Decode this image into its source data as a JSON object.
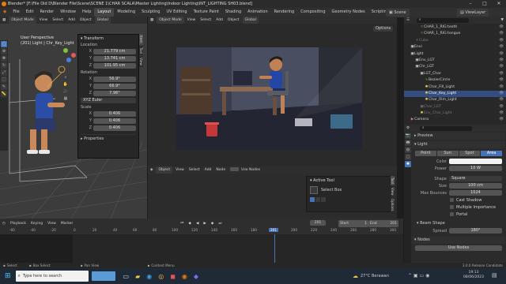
{
  "window": {
    "title": "Blender* [F:\\File Old D\\Blender File\\Scene\\SCENE 1\\CHAR SCALA\\Master Lighting\\Indoor Lighting\\INT_LIGHTING SH03.blend]"
  },
  "menu": {
    "items": [
      "File",
      "Edit",
      "Render",
      "Window",
      "Help"
    ],
    "workspaces": [
      "Layout",
      "Modeling",
      "Sculpting",
      "UV Editing",
      "Texture Paint",
      "Shading",
      "Animation",
      "Rendering",
      "Compositing",
      "Geometry Nodes",
      "Scripting"
    ],
    "active_workspace": "Layout",
    "scene_label": "Scene",
    "viewlayer_label": "ViewLayer"
  },
  "left_viewport": {
    "mode": "Object Mode",
    "menus": [
      "View",
      "Select",
      "Add",
      "Object"
    ],
    "orientation": "Global",
    "view_name": "User Perspective",
    "collection_info": "(201) Light | Chr_Key_Light",
    "tools": [
      "cursor-icon",
      "move-icon",
      "rotate-icon",
      "scale-icon",
      "transform-icon",
      "annotate-icon",
      "measure-icon"
    ]
  },
  "transform_panel": {
    "title": "Transform",
    "location_label": "Location",
    "location": [
      {
        "axis": "X",
        "value": "21.779 cm"
      },
      {
        "axis": "Y",
        "value": "13.741 cm"
      },
      {
        "axis": "Z",
        "value": "101.95 cm"
      }
    ],
    "rotation_label": "Rotation",
    "rotation": [
      {
        "axis": "X",
        "value": "56.9°"
      },
      {
        "axis": "Y",
        "value": "66.9°"
      },
      {
        "axis": "Z",
        "value": "7.96°"
      }
    ],
    "rotation_mode": "XYZ Euler",
    "scale_label": "Scale",
    "scale": [
      {
        "axis": "X",
        "value": "0.406"
      },
      {
        "axis": "Y",
        "value": "0.406"
      },
      {
        "axis": "Z",
        "value": "0.406"
      }
    ],
    "properties_label": "Properties",
    "side_tabs": [
      "Item",
      "Tool",
      "View"
    ]
  },
  "camera_viewport": {
    "mode": "Object Mode",
    "menus": [
      "View",
      "Select",
      "Add",
      "Object"
    ],
    "orientation": "Global",
    "options_label": "Options"
  },
  "node_editor": {
    "type": "Object",
    "menus": [
      "View",
      "Select",
      "Add",
      "Node"
    ],
    "use_nodes_label": "Use Nodes",
    "active_tool_title": "Active Tool",
    "active_tool": "Select Box",
    "side_tabs": [
      "Tool",
      "View",
      "Options"
    ]
  },
  "timeline": {
    "menus": [
      "Playback",
      "Keying",
      "View",
      "Marker"
    ],
    "current_frame": "201",
    "start_label": "Start",
    "start": "1",
    "end_label": "End",
    "end": "201",
    "ticks": [
      "-60",
      "-40",
      "-20",
      "0",
      "20",
      "40",
      "60",
      "80",
      "100",
      "120",
      "140",
      "160",
      "180",
      "200",
      "220",
      "240",
      "260",
      "280",
      "300",
      "320"
    ]
  },
  "status_bar": {
    "items": [
      "Select",
      "Box Select",
      "Pan View",
      "Context Menu"
    ],
    "version": "3.0.0 Release Candidate"
  },
  "outliner": {
    "items": [
      {
        "name": "CHAR_1_RIG:teeth",
        "indent": 3,
        "icon": "mesh-icon",
        "selected": false
      },
      {
        "name": "CHAR_1_RIG:tongue",
        "indent": 3,
        "icon": "mesh-icon",
        "selected": false
      },
      {
        "name": "Cube",
        "indent": 2,
        "icon": "mesh-icon",
        "selected": false
      },
      {
        "name": "Envi",
        "indent": 1,
        "icon": "collection-icon",
        "selected": false
      },
      {
        "name": "Light",
        "indent": 1,
        "icon": "collection-icon",
        "selected": false
      },
      {
        "name": "Env_LGT",
        "indent": 2,
        "icon": "collection-icon",
        "selected": false
      },
      {
        "name": "Chr_LGT",
        "indent": 2,
        "icon": "collection-icon",
        "selected": false
      },
      {
        "name": "LGT_Char",
        "indent": 3,
        "icon": "collection-icon",
        "selected": false
      },
      {
        "name": "BezierCircle",
        "indent": 4,
        "icon": "curve-icon",
        "selected": false
      },
      {
        "name": "Char_Fill_Light",
        "indent": 4,
        "icon": "light-icon",
        "selected": false
      },
      {
        "name": "Char_Key_Light",
        "indent": 4,
        "icon": "light-icon",
        "selected": true
      },
      {
        "name": "Char_Rim_Light",
        "indent": 4,
        "icon": "light-icon",
        "selected": false
      },
      {
        "name": "Char_LGT",
        "indent": 3,
        "icon": "collection-icon",
        "selected": false
      },
      {
        "name": "Env_Char_Light",
        "indent": 3,
        "icon": "light-icon",
        "selected": false
      },
      {
        "name": "Camera",
        "indent": 1,
        "icon": "camera-icon",
        "selected": false
      }
    ]
  },
  "properties": {
    "sections": [
      "Preview",
      "Light"
    ],
    "light_types": [
      "Point",
      "Sun",
      "Spot",
      "Area"
    ],
    "active_light_type": "Area",
    "color_label": "Color",
    "power_label": "Power",
    "power": "10 W",
    "shape_label": "Shape",
    "shape": "Square",
    "size_label": "Size",
    "size": "100 cm",
    "max_bounces_label": "Max Bounces",
    "max_bounces": "1024",
    "cast_shadow": "Cast Shadow",
    "multiple_importance": "Multiple Importance",
    "portal": "Portal",
    "beam_shape_label": "Beam Shape",
    "spread_label": "Spread",
    "spread": "180°",
    "nodes_label": "Nodes",
    "use_nodes_button": "Use Nodes"
  },
  "taskbar": {
    "search_placeholder": "Type here to search",
    "weather": "27°C Berawan",
    "time": "19:13",
    "date": "08/06/2023"
  }
}
